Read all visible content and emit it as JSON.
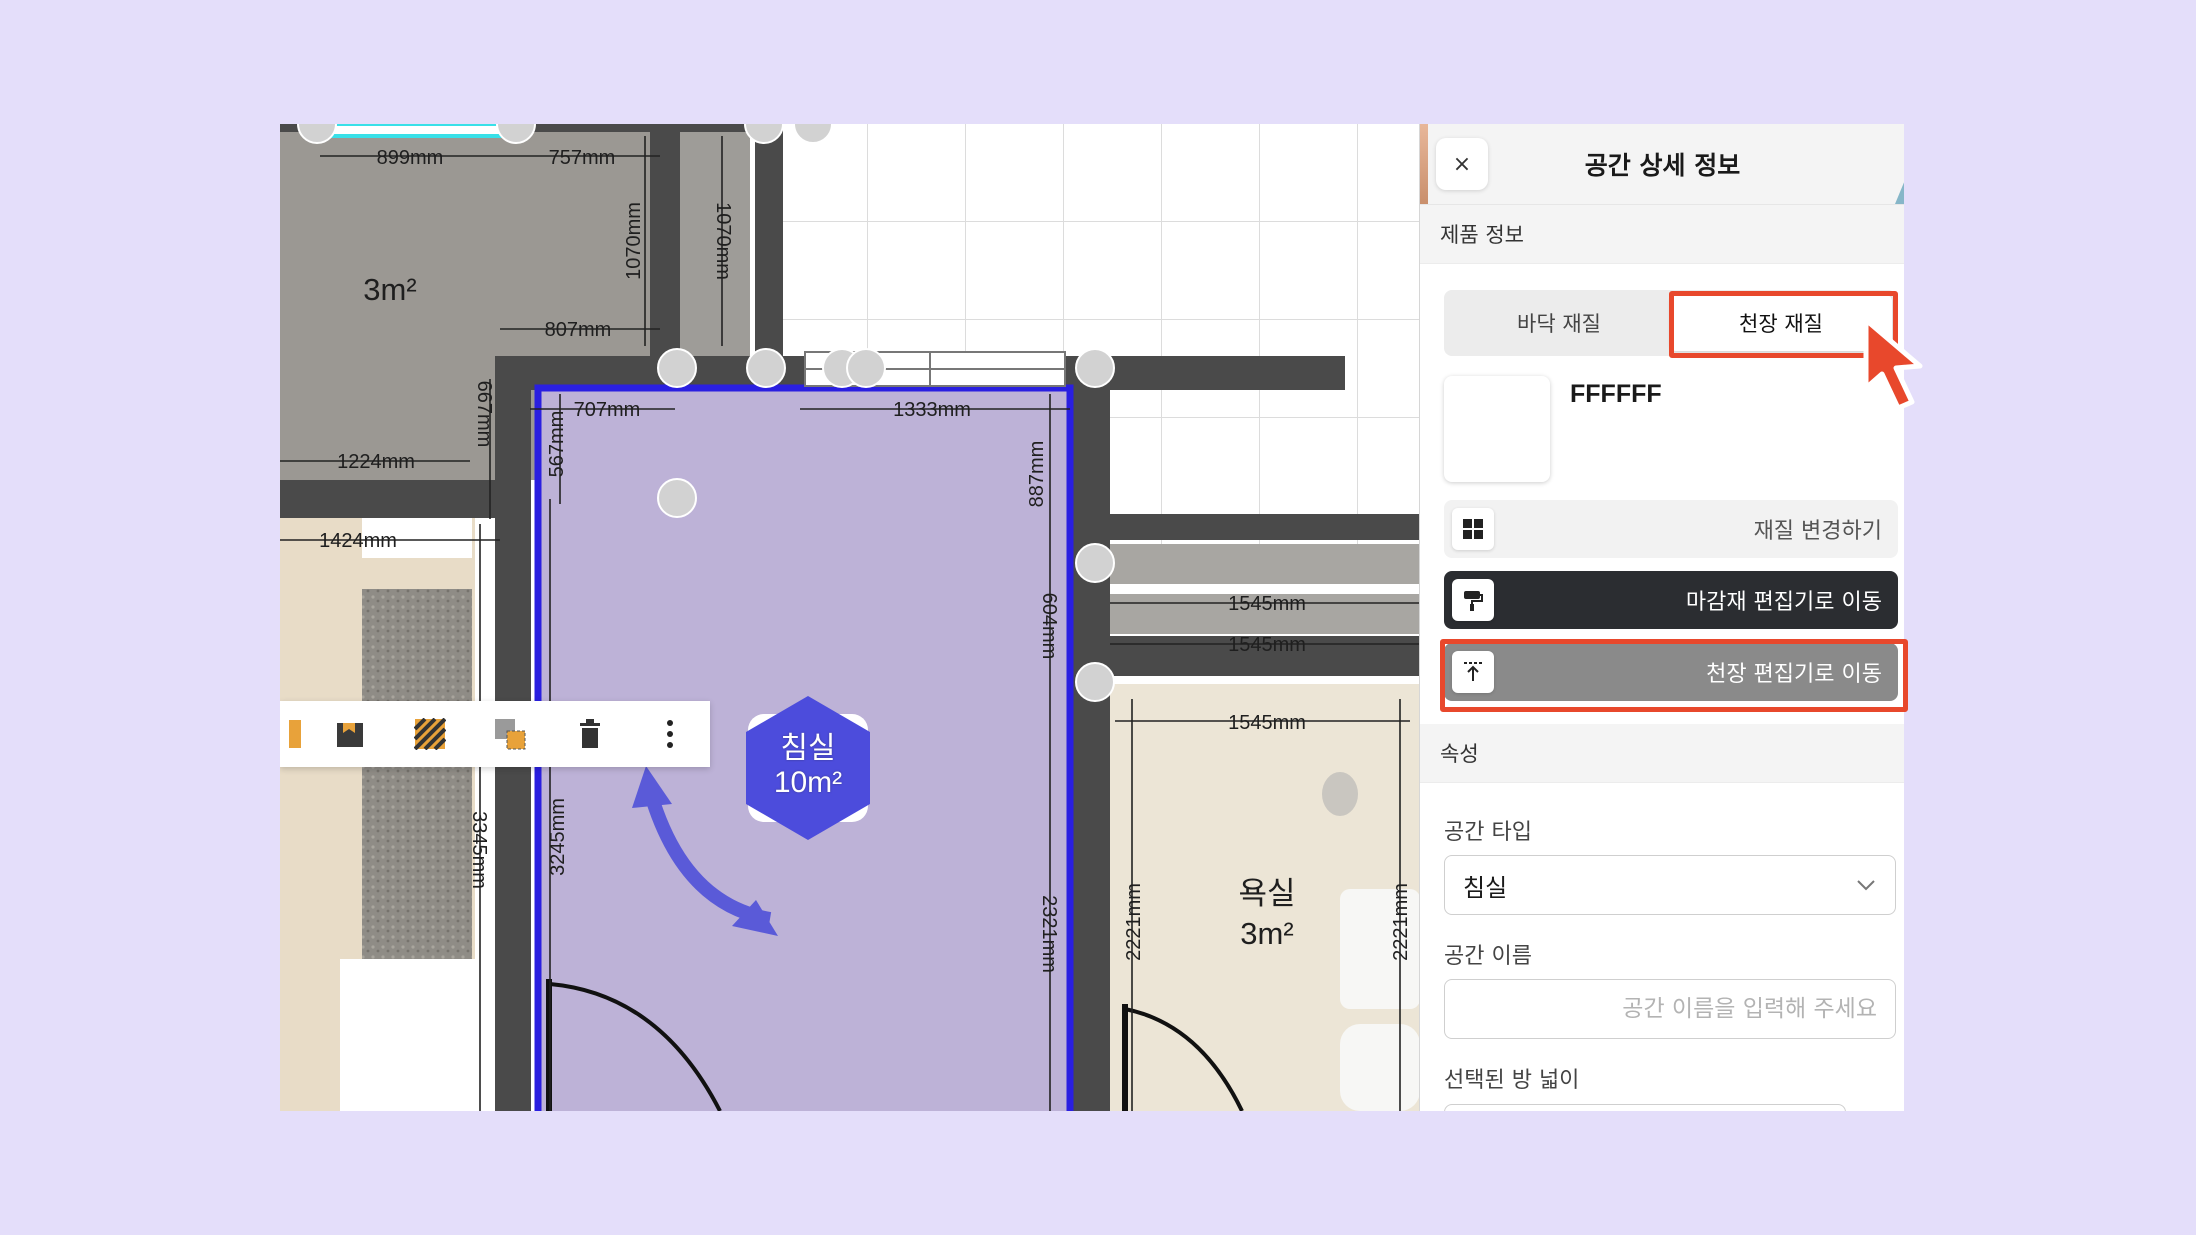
{
  "plan": {
    "dims": {
      "d899": "899mm",
      "d757": "757mm",
      "d1070a": "1070mm",
      "d1070b": "1070mm",
      "d807": "807mm",
      "d707": "707mm",
      "d1333": "1333mm",
      "d667": "667mm",
      "d567": "567mm",
      "d887": "887mm",
      "d1224": "1224mm",
      "d1424": "1424mm",
      "d604": "604mm",
      "d1545a": "1545mm",
      "d1545b": "1545mm",
      "d1545c": "1545mm",
      "d3345": "3345mm",
      "d3245": "3245mm",
      "d2321": "2321mm",
      "d2221a": "2221mm",
      "d2221b": "2221mm"
    },
    "rooms": {
      "small_area": "3m²",
      "bath_name": "욕실",
      "bath_area": "3m²"
    },
    "selected_room": {
      "name": "침실",
      "area": "10m²"
    }
  },
  "toolbar": {
    "icons": [
      "partial-icon",
      "floor-material-icon",
      "hatch-pattern-icon",
      "copy-style-icon",
      "trash-icon",
      "more-icon"
    ]
  },
  "panel": {
    "title": "공간 상세 정보",
    "close_symbol": "×",
    "product_section": "제품 정보",
    "tabs": [
      "바닥 재질",
      "천장 재질"
    ],
    "active_tab": "천장 재질",
    "color_code": "FFFFFF",
    "btn_change_material": "재질 변경하기",
    "btn_finish_editor": "마감재 편집기로 이동",
    "btn_ceiling_editor": "천장 편집기로 이동",
    "attributes_section": "속성",
    "space_type_label": "공간 타입",
    "space_type_value": "침실",
    "space_name_label": "공간 이름",
    "space_name_placeholder": "공간 이름을 입력해 주세요",
    "room_width_label": "선택된 방 넓이"
  },
  "colors": {
    "highlight": "#e8482c",
    "selected_room_fill": "#bdb2d7",
    "selected_outline": "#2a1fe0",
    "hex_badge": "#4c4cdc",
    "dark_button": "#2b2d31"
  }
}
